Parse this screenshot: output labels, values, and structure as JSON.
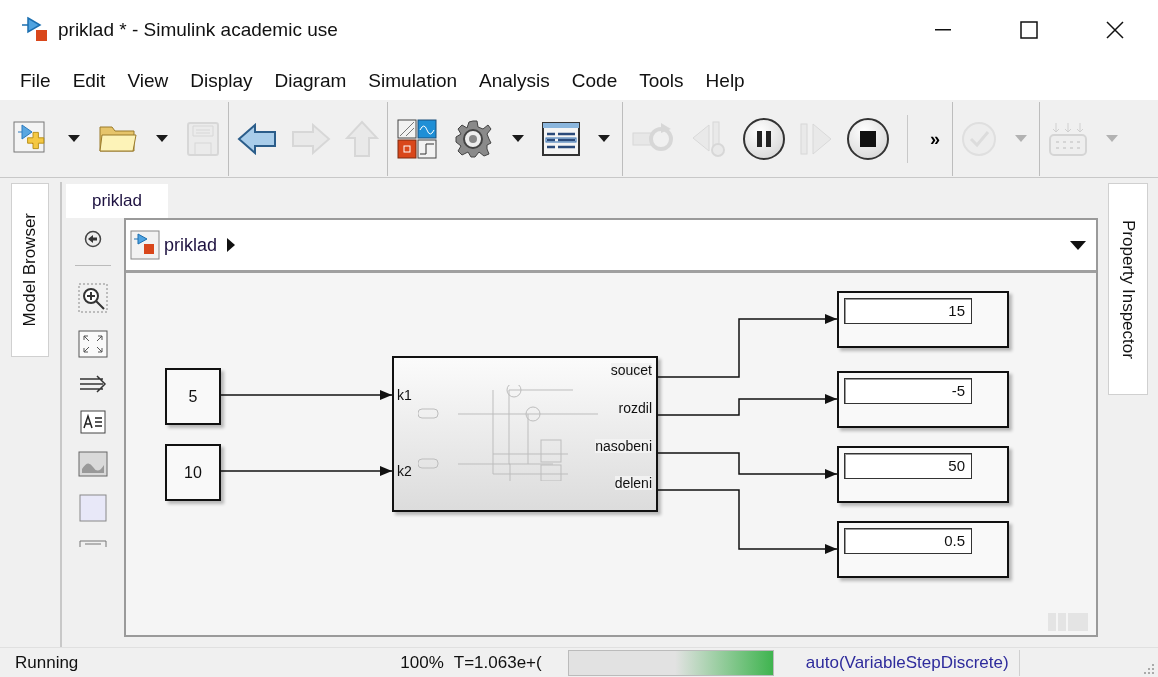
{
  "window": {
    "title": "priklad * - Simulink academic use"
  },
  "menu": [
    "File",
    "Edit",
    "View",
    "Display",
    "Diagram",
    "Simulation",
    "Analysis",
    "Code",
    "Tools",
    "Help"
  ],
  "toolbar": [
    [
      {
        "kind": "new-model",
        "disabled": false
      },
      {
        "kind": "caret",
        "disabled": false
      },
      {
        "kind": "open",
        "disabled": false
      },
      {
        "kind": "caret",
        "disabled": false
      },
      {
        "kind": "save",
        "disabled": true
      }
    ],
    [
      {
        "kind": "back",
        "disabled": false
      },
      {
        "kind": "forward",
        "disabled": true
      },
      {
        "kind": "up",
        "disabled": true
      }
    ],
    [
      {
        "kind": "library",
        "disabled": false
      },
      {
        "kind": "settings",
        "disabled": false
      },
      {
        "kind": "caret",
        "disabled": false
      },
      {
        "kind": "config",
        "disabled": false
      },
      {
        "kind": "caret",
        "disabled": false
      }
    ],
    [
      {
        "kind": "update",
        "disabled": true
      },
      {
        "kind": "step-back",
        "disabled": true
      },
      {
        "kind": "pause",
        "disabled": false
      },
      {
        "kind": "step-forward",
        "disabled": true
      },
      {
        "kind": "stop",
        "disabled": false
      },
      {
        "kind": "divider"
      },
      {
        "kind": "overflow",
        "label": "»"
      }
    ],
    [
      {
        "kind": "check",
        "disabled": true
      },
      {
        "kind": "caret",
        "disabled": true
      }
    ],
    [
      {
        "kind": "ports",
        "disabled": true
      },
      {
        "kind": "caret",
        "disabled": true
      }
    ]
  ],
  "side_tabs": {
    "left": "Model Browser",
    "right": "Property Inspector"
  },
  "editor_tab": {
    "label": "priklad",
    "selected": true
  },
  "breadcrumb": {
    "label": "priklad"
  },
  "diagram": {
    "constants": [
      "5",
      "10"
    ],
    "subsystem": {
      "inputs": [
        "k1",
        "k2"
      ],
      "outputs": [
        "soucet",
        "rozdil",
        "nasobeni",
        "deleni"
      ]
    },
    "displays": [
      "15",
      "-5",
      "50",
      "0.5"
    ]
  },
  "status_bar": {
    "state": "Running",
    "zoom": "100%",
    "time": "T=1.063e+(",
    "solver": "auto(VariableStepDiscrete)"
  }
}
